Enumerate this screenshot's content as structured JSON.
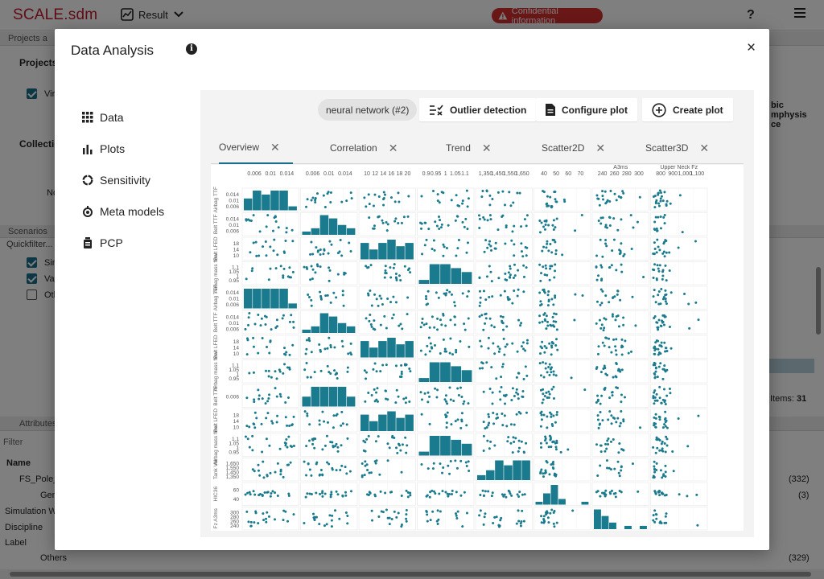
{
  "app": {
    "brand": "SCALE.sdm",
    "result_menu": "Result",
    "confidential": "Confidential information",
    "help": "?"
  },
  "background": {
    "projects_bar": "Projects a",
    "projects_title": "Projects",
    "project_item": "Vir",
    "collections_title": "Collectio",
    "collections_empty": "No",
    "scenarios_bar": "Scenarios",
    "quickfilter": "Quickfilter...",
    "scenario_items": [
      "Sin",
      "Va",
      "Oth"
    ],
    "attributes_bar": "Attributes",
    "filter_placeholder": "Filter",
    "name_header": "Name",
    "tree_root": "FS_Pole_",
    "tree_gen": "Gen",
    "rows": [
      "Simulation Wa",
      "Discipline",
      "Label"
    ],
    "others": "Others",
    "right_col": [
      "bic",
      "mphysis",
      "ce"
    ],
    "items_label": "Items:",
    "items_count": "31",
    "counts": [
      "(332)",
      "(3)",
      "(329)"
    ]
  },
  "modal": {
    "title": "Data Analysis",
    "close": "×",
    "nav": [
      {
        "label": "Data",
        "icon": "grid-icon"
      },
      {
        "label": "Plots",
        "icon": "bar-chart-icon"
      },
      {
        "label": "Sensitivity",
        "icon": "donut-icon"
      },
      {
        "label": "Meta models",
        "icon": "meta-model-icon"
      },
      {
        "label": "PCP",
        "icon": "pcp-icon"
      }
    ],
    "model_pill": "neural network (#2)",
    "buttons": {
      "outlier": "Outlier detection",
      "configure": "Configure plot",
      "create": "Create plot"
    },
    "tabs": [
      "Overview",
      "Correlation",
      "Trend",
      "Scatter2D",
      "Scatter3D"
    ],
    "active_tab": "Overview"
  },
  "chart_data": {
    "type": "scatter",
    "layout": "scatter-matrix",
    "title": "",
    "top_ticks": [
      [
        "0.006",
        "0.01",
        "0.014"
      ],
      [
        "0.006",
        "0.01",
        "0.014"
      ],
      [
        "10",
        "12",
        "14",
        "16",
        "18",
        "20"
      ],
      [
        "0.9",
        "0.95",
        "1",
        "1.05",
        "1.1"
      ],
      [
        "1,350",
        "1,450",
        "1,550",
        "1,650"
      ],
      [
        "40",
        "50",
        "60",
        "70"
      ],
      [
        "240",
        "260",
        "280",
        "300"
      ],
      [
        "800",
        "900",
        "1,000",
        "1,100"
      ]
    ],
    "top_labels": [
      "",
      "",
      "",
      "",
      "",
      "",
      "A3ms",
      "Upper Neck Fz"
    ],
    "row_labels": [
      "Airbag TTF",
      "Belt TTF",
      "Belt LFED",
      "Airbag mass flow",
      "Airbag TTF",
      "Belt TTF",
      "Belt LFED",
      "Airbag mass flow",
      "Belt TTF",
      "Belt LFED",
      "Airbag mass flow",
      "Tank Vol",
      "HIC36",
      "Fz A3ms"
    ],
    "row_ticks": [
      [
        "0.014",
        "0.01",
        "0.006"
      ],
      [
        "0.014",
        "0.01",
        "0.006"
      ],
      [
        "18",
        "14",
        "10"
      ],
      [
        "1.1",
        "1.05",
        "1",
        "0.95"
      ],
      [
        "0.014",
        "0.01",
        "0.006"
      ],
      [
        "0.014",
        "0.01",
        "0.006"
      ],
      [
        "18",
        "14",
        "10"
      ],
      [
        "1.1",
        "1.05",
        "1",
        "0.95"
      ],
      [
        "0.006"
      ],
      [
        "18",
        "14",
        "10"
      ],
      [
        "1.1",
        "1.05",
        "1",
        "0.95"
      ],
      [
        "1,650",
        "1,550",
        "1,450",
        "1,350"
      ],
      [
        "60",
        "40"
      ],
      [
        "300",
        "280",
        "260",
        "240"
      ]
    ],
    "diagonal_histograms": [
      {
        "row": 0,
        "col": 0,
        "values": [
          3,
          5,
          4,
          5,
          5,
          1
        ]
      },
      {
        "row": 1,
        "col": 1,
        "values": [
          1,
          2,
          6,
          5,
          3,
          2
        ]
      },
      {
        "row": 2,
        "col": 2,
        "values": [
          5,
          3,
          5,
          6,
          4,
          5
        ]
      },
      {
        "row": 3,
        "col": 3,
        "values": [
          1,
          5,
          5,
          4,
          3
        ]
      },
      {
        "row": 4,
        "col": 0,
        "values": [
          4,
          4,
          4,
          4,
          4,
          1
        ]
      },
      {
        "row": 5,
        "col": 1,
        "values": [
          1,
          2,
          6,
          5,
          3,
          2
        ]
      },
      {
        "row": 6,
        "col": 2,
        "values": [
          5,
          3,
          5,
          6,
          4,
          5
        ]
      },
      {
        "row": 7,
        "col": 3,
        "values": [
          1,
          5,
          5,
          4,
          3
        ]
      },
      {
        "row": 8,
        "col": 1,
        "values": [
          1,
          2,
          2,
          2,
          2,
          1
        ]
      },
      {
        "row": 9,
        "col": 2,
        "values": [
          5,
          3,
          5,
          6,
          4,
          5
        ]
      },
      {
        "row": 10,
        "col": 3,
        "values": [
          1,
          5,
          5,
          4,
          3
        ]
      },
      {
        "row": 11,
        "col": 4,
        "values": [
          1,
          2,
          4,
          3,
          4,
          4
        ]
      },
      {
        "row": 12,
        "col": 5,
        "values": [
          1,
          4,
          7,
          2,
          0,
          0,
          1
        ]
      },
      {
        "row": 13,
        "col": 6,
        "values": [
          6,
          4,
          2,
          0,
          1,
          0,
          1
        ]
      }
    ],
    "series": [
      {
        "values": []
      }
    ],
    "grid": true,
    "legend": "none",
    "series_color": "#1a7a8e"
  }
}
